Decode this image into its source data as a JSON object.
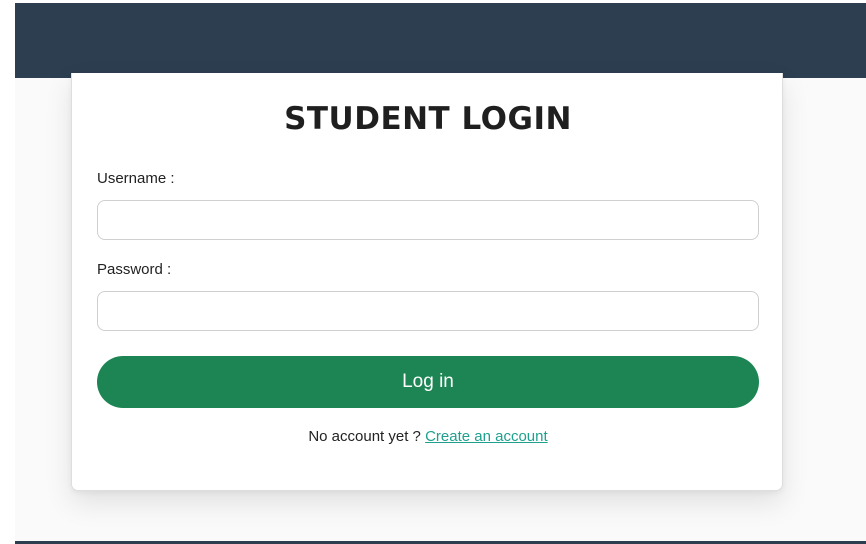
{
  "page": {
    "title": "STUDENT LOGIN"
  },
  "form": {
    "username_label": "Username :",
    "username_value": "",
    "password_label": "Password :",
    "password_value": "",
    "login_label": "Log in"
  },
  "signup": {
    "prompt": "No account yet ?",
    "link_label": "Create an account"
  },
  "colors": {
    "header_bg": "#2e3e51",
    "button_bg": "#1d8553",
    "link": "#1fa08f"
  }
}
